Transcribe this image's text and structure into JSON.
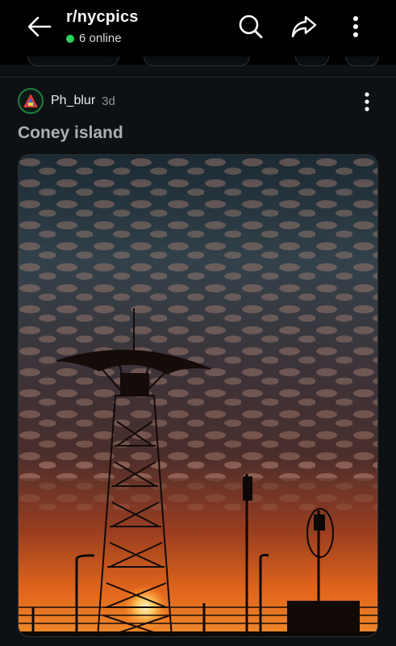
{
  "header": {
    "subreddit": "r/nycpics",
    "online_text": "6 online",
    "icons": {
      "back": "arrow-left-icon",
      "search": "search-icon",
      "share": "share-icon",
      "more": "more-vertical-icon"
    }
  },
  "post": {
    "author": "Ph_blur",
    "age": "3d",
    "title": "Coney island",
    "media_description": "Silhouette of the Parachute Jump tower at Coney Island against an orange sunset sky with mackerel clouds",
    "more_icon": "more-vertical-icon"
  },
  "colors": {
    "background": "#0e1113",
    "topbar": "#000000",
    "online_dot": "#2bd45b",
    "title_text": "#a9b1b6"
  }
}
